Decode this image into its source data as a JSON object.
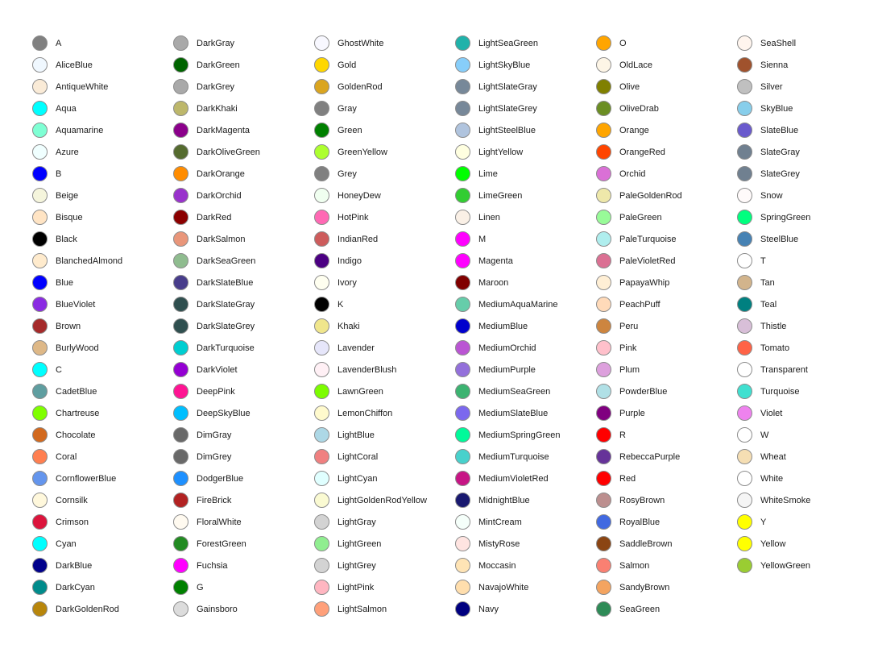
{
  "columns": [
    [
      {
        "name": "A",
        "color": "#808080"
      },
      {
        "name": "AliceBlue",
        "color": "#F0F8FF"
      },
      {
        "name": "AntiqueWhite",
        "color": "#FAEBD7"
      },
      {
        "name": "Aqua",
        "color": "#00FFFF"
      },
      {
        "name": "Aquamarine",
        "color": "#7FFFD4"
      },
      {
        "name": "Azure",
        "color": "#F0FFFF"
      },
      {
        "name": "B",
        "color": "#0000FF"
      },
      {
        "name": "Beige",
        "color": "#F5F5DC"
      },
      {
        "name": "Bisque",
        "color": "#FFE4C4"
      },
      {
        "name": "Black",
        "color": "#000000"
      },
      {
        "name": "BlanchedAlmond",
        "color": "#FFEBCD"
      },
      {
        "name": "Blue",
        "color": "#0000FF"
      },
      {
        "name": "BlueViolet",
        "color": "#8A2BE2"
      },
      {
        "name": "Brown",
        "color": "#A52A2A"
      },
      {
        "name": "BurlyWood",
        "color": "#DEB887"
      },
      {
        "name": "C",
        "color": "#00FFFF"
      },
      {
        "name": "CadetBlue",
        "color": "#5F9EA0"
      },
      {
        "name": "Chartreuse",
        "color": "#7FFF00"
      },
      {
        "name": "Chocolate",
        "color": "#D2691E"
      },
      {
        "name": "Coral",
        "color": "#FF7F50"
      },
      {
        "name": "CornflowerBlue",
        "color": "#6495ED"
      },
      {
        "name": "Cornsilk",
        "color": "#FFF8DC"
      },
      {
        "name": "Crimson",
        "color": "#DC143C"
      },
      {
        "name": "Cyan",
        "color": "#00FFFF"
      },
      {
        "name": "DarkBlue",
        "color": "#00008B"
      },
      {
        "name": "DarkCyan",
        "color": "#008B8B"
      },
      {
        "name": "DarkGoldenRod",
        "color": "#B8860B"
      }
    ],
    [
      {
        "name": "DarkGray",
        "color": "#A9A9A9"
      },
      {
        "name": "DarkGreen",
        "color": "#006400"
      },
      {
        "name": "DarkGrey",
        "color": "#A9A9A9"
      },
      {
        "name": "DarkKhaki",
        "color": "#BDB76B"
      },
      {
        "name": "DarkMagenta",
        "color": "#8B008B"
      },
      {
        "name": "DarkOliveGreen",
        "color": "#556B2F"
      },
      {
        "name": "DarkOrange",
        "color": "#FF8C00"
      },
      {
        "name": "DarkOrchid",
        "color": "#9932CC"
      },
      {
        "name": "DarkRed",
        "color": "#8B0000"
      },
      {
        "name": "DarkSalmon",
        "color": "#E9967A"
      },
      {
        "name": "DarkSeaGreen",
        "color": "#8FBC8F"
      },
      {
        "name": "DarkSlateBlue",
        "color": "#483D8B"
      },
      {
        "name": "DarkSlateGray",
        "color": "#2F4F4F"
      },
      {
        "name": "DarkSlateGrey",
        "color": "#2F4F4F"
      },
      {
        "name": "DarkTurquoise",
        "color": "#00CED1"
      },
      {
        "name": "DarkViolet",
        "color": "#9400D3"
      },
      {
        "name": "DeepPink",
        "color": "#FF1493"
      },
      {
        "name": "DeepSkyBlue",
        "color": "#00BFFF"
      },
      {
        "name": "DimGray",
        "color": "#696969"
      },
      {
        "name": "DimGrey",
        "color": "#696969"
      },
      {
        "name": "DodgerBlue",
        "color": "#1E90FF"
      },
      {
        "name": "FireBrick",
        "color": "#B22222"
      },
      {
        "name": "FloralWhite",
        "color": "#FFFAF0"
      },
      {
        "name": "ForestGreen",
        "color": "#228B22"
      },
      {
        "name": "Fuchsia",
        "color": "#FF00FF"
      },
      {
        "name": "G",
        "color": "#008000"
      },
      {
        "name": "Gainsboro",
        "color": "#DCDCDC"
      }
    ],
    [
      {
        "name": "GhostWhite",
        "color": "#F8F8FF"
      },
      {
        "name": "Gold",
        "color": "#FFD700"
      },
      {
        "name": "GoldenRod",
        "color": "#DAA520"
      },
      {
        "name": "Gray",
        "color": "#808080"
      },
      {
        "name": "Green",
        "color": "#008000"
      },
      {
        "name": "GreenYellow",
        "color": "#ADFF2F"
      },
      {
        "name": "Grey",
        "color": "#808080"
      },
      {
        "name": "HoneyDew",
        "color": "#F0FFF0"
      },
      {
        "name": "HotPink",
        "color": "#FF69B4"
      },
      {
        "name": "IndianRed",
        "color": "#CD5C5C"
      },
      {
        "name": "Indigo",
        "color": "#4B0082"
      },
      {
        "name": "Ivory",
        "color": "#FFFFF0"
      },
      {
        "name": "K",
        "color": "#000000"
      },
      {
        "name": "Khaki",
        "color": "#F0E68C"
      },
      {
        "name": "Lavender",
        "color": "#E6E6FA"
      },
      {
        "name": "LavenderBlush",
        "color": "#FFF0F5"
      },
      {
        "name": "LawnGreen",
        "color": "#7CFC00"
      },
      {
        "name": "LemonChiffon",
        "color": "#FFFACD"
      },
      {
        "name": "LightBlue",
        "color": "#ADD8E6"
      },
      {
        "name": "LightCoral",
        "color": "#F08080"
      },
      {
        "name": "LightCyan",
        "color": "#E0FFFF"
      },
      {
        "name": "LightGoldenRodYellow",
        "color": "#FAFAD2"
      },
      {
        "name": "LightGray",
        "color": "#D3D3D3"
      },
      {
        "name": "LightGreen",
        "color": "#90EE90"
      },
      {
        "name": "LightGrey",
        "color": "#D3D3D3"
      },
      {
        "name": "LightPink",
        "color": "#FFB6C1"
      },
      {
        "name": "LightSalmon",
        "color": "#FFA07A"
      }
    ],
    [
      {
        "name": "LightSeaGreen",
        "color": "#20B2AA"
      },
      {
        "name": "LightSkyBlue",
        "color": "#87CEFA"
      },
      {
        "name": "LightSlateGray",
        "color": "#778899"
      },
      {
        "name": "LightSlateGrey",
        "color": "#778899"
      },
      {
        "name": "LightSteelBlue",
        "color": "#B0C4DE"
      },
      {
        "name": "LightYellow",
        "color": "#FFFFE0"
      },
      {
        "name": "Lime",
        "color": "#00FF00"
      },
      {
        "name": "LimeGreen",
        "color": "#32CD32"
      },
      {
        "name": "Linen",
        "color": "#FAF0E6"
      },
      {
        "name": "M",
        "color": "#FF00FF"
      },
      {
        "name": "Magenta",
        "color": "#FF00FF"
      },
      {
        "name": "Maroon",
        "color": "#800000"
      },
      {
        "name": "MediumAquaMarine",
        "color": "#66CDAA"
      },
      {
        "name": "MediumBlue",
        "color": "#0000CD"
      },
      {
        "name": "MediumOrchid",
        "color": "#BA55D3"
      },
      {
        "name": "MediumPurple",
        "color": "#9370DB"
      },
      {
        "name": "MediumSeaGreen",
        "color": "#3CB371"
      },
      {
        "name": "MediumSlateBlue",
        "color": "#7B68EE"
      },
      {
        "name": "MediumSpringGreen",
        "color": "#00FA9A"
      },
      {
        "name": "MediumTurquoise",
        "color": "#48D1CC"
      },
      {
        "name": "MediumVioletRed",
        "color": "#C71585"
      },
      {
        "name": "MidnightBlue",
        "color": "#191970"
      },
      {
        "name": "MintCream",
        "color": "#F5FFFA"
      },
      {
        "name": "MistyRose",
        "color": "#FFE4E1"
      },
      {
        "name": "Moccasin",
        "color": "#FFE4B5"
      },
      {
        "name": "NavajoWhite",
        "color": "#FFDEAD"
      },
      {
        "name": "Navy",
        "color": "#000080"
      }
    ],
    [
      {
        "name": "O",
        "color": "#FFA500"
      },
      {
        "name": "OldLace",
        "color": "#FDF5E6"
      },
      {
        "name": "Olive",
        "color": "#808000"
      },
      {
        "name": "OliveDrab",
        "color": "#6B8E23"
      },
      {
        "name": "Orange",
        "color": "#FFA500"
      },
      {
        "name": "OrangeRed",
        "color": "#FF4500"
      },
      {
        "name": "Orchid",
        "color": "#DA70D6"
      },
      {
        "name": "PaleGoldenRod",
        "color": "#EEE8AA"
      },
      {
        "name": "PaleGreen",
        "color": "#98FB98"
      },
      {
        "name": "PaleTurquoise",
        "color": "#AFEEEE"
      },
      {
        "name": "PaleVioletRed",
        "color": "#DB7093"
      },
      {
        "name": "PapayaWhip",
        "color": "#FFEFD5"
      },
      {
        "name": "PeachPuff",
        "color": "#FFDAB9"
      },
      {
        "name": "Peru",
        "color": "#CD853F"
      },
      {
        "name": "Pink",
        "color": "#FFC0CB"
      },
      {
        "name": "Plum",
        "color": "#DDA0DD"
      },
      {
        "name": "PowderBlue",
        "color": "#B0E0E6"
      },
      {
        "name": "Purple",
        "color": "#800080"
      },
      {
        "name": "R",
        "color": "#FF0000"
      },
      {
        "name": "RebeccaPurple",
        "color": "#663399"
      },
      {
        "name": "Red",
        "color": "#FF0000"
      },
      {
        "name": "RosyBrown",
        "color": "#BC8F8F"
      },
      {
        "name": "RoyalBlue",
        "color": "#4169E1"
      },
      {
        "name": "SaddleBrown",
        "color": "#8B4513"
      },
      {
        "name": "Salmon",
        "color": "#FA8072"
      },
      {
        "name": "SandyBrown",
        "color": "#F4A460"
      },
      {
        "name": "SeaGreen",
        "color": "#2E8B57"
      }
    ],
    [
      {
        "name": "SeaShell",
        "color": "#FFF5EE"
      },
      {
        "name": "Sienna",
        "color": "#A0522D"
      },
      {
        "name": "Silver",
        "color": "#C0C0C0"
      },
      {
        "name": "SkyBlue",
        "color": "#87CEEB"
      },
      {
        "name": "SlateBlue",
        "color": "#6A5ACD"
      },
      {
        "name": "SlateGray",
        "color": "#708090"
      },
      {
        "name": "SlateGrey",
        "color": "#708090"
      },
      {
        "name": "Snow",
        "color": "#FFFAFA"
      },
      {
        "name": "SpringGreen",
        "color": "#00FF7F"
      },
      {
        "name": "SteelBlue",
        "color": "#4682B4"
      },
      {
        "name": "T",
        "color": "#FFFFFF"
      },
      {
        "name": "Tan",
        "color": "#D2B48C"
      },
      {
        "name": "Teal",
        "color": "#008080"
      },
      {
        "name": "Thistle",
        "color": "#D8BFD8"
      },
      {
        "name": "Tomato",
        "color": "#FF6347"
      },
      {
        "name": "Transparent",
        "color": "#FFFFFF"
      },
      {
        "name": "Turquoise",
        "color": "#40E0D0"
      },
      {
        "name": "Violet",
        "color": "#EE82EE"
      },
      {
        "name": "W",
        "color": "#FFFFFF"
      },
      {
        "name": "Wheat",
        "color": "#F5DEB3"
      },
      {
        "name": "White",
        "color": "#FFFFFF"
      },
      {
        "name": "WhiteSmoke",
        "color": "#F5F5F5"
      },
      {
        "name": "Y",
        "color": "#FFFF00"
      },
      {
        "name": "Yellow",
        "color": "#FFFF00"
      },
      {
        "name": "YellowGreen",
        "color": "#9ACD32"
      }
    ]
  ]
}
